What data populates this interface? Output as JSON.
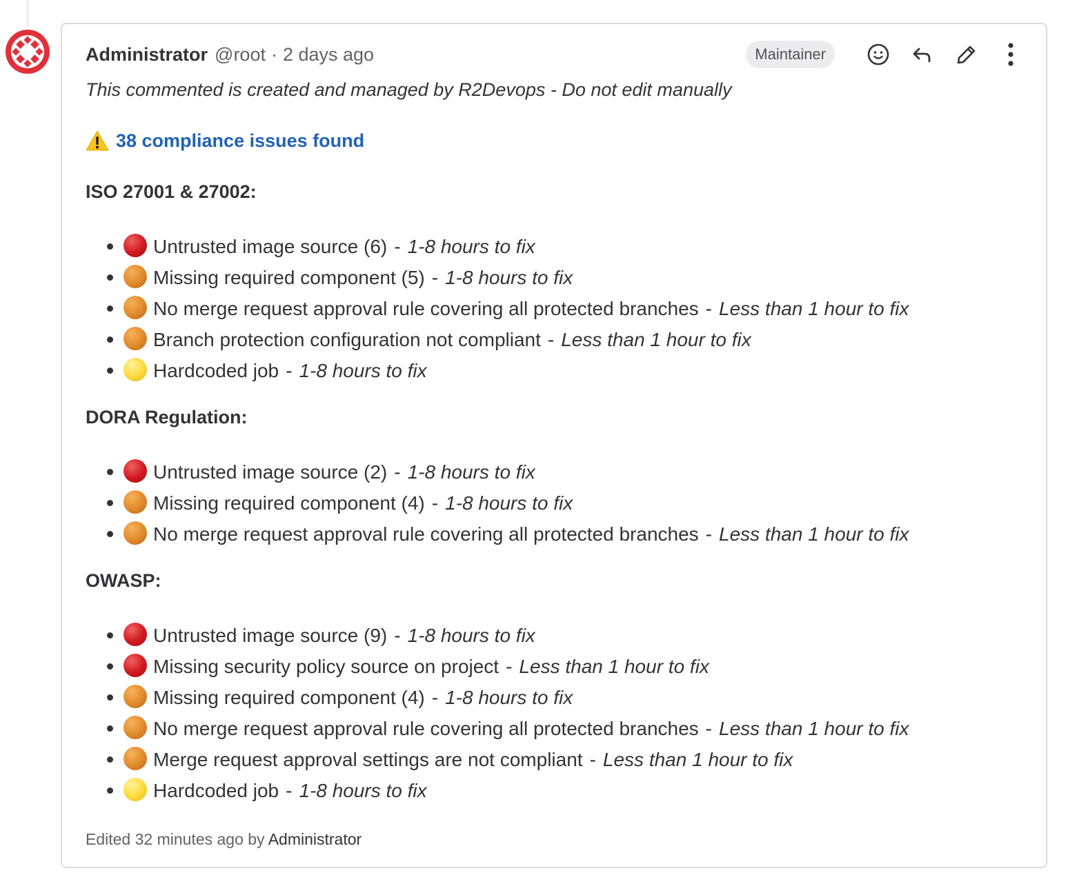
{
  "note": {
    "author_name": "Administrator",
    "author_handle": "@root",
    "separator": "·",
    "timestamp": "2 days ago",
    "role_badge": "Maintainer",
    "actions": [
      "add-reaction",
      "reply",
      "edit",
      "more-actions"
    ],
    "intro": "This commented is created and managed by R2Devops - Do not edit manually",
    "summary": "38 compliance issues found",
    "footer": {
      "edited_prefix": "Edited 32 minutes ago by",
      "edited_by": "Administrator"
    }
  },
  "sections": [
    {
      "title": "ISO 27001 & 27002:",
      "items": [
        {
          "severity": "red",
          "text": "Untrusted image source (6)",
          "time": "1-8 hours to fix"
        },
        {
          "severity": "orange",
          "text": "Missing required component (5)",
          "time": "1-8 hours to fix"
        },
        {
          "severity": "orange",
          "text": "No merge request approval rule covering all protected branches",
          "time": "Less than 1 hour to fix"
        },
        {
          "severity": "orange",
          "text": "Branch protection configuration not compliant",
          "time": "Less than 1 hour to fix"
        },
        {
          "severity": "yellow",
          "text": "Hardcoded job",
          "time": "1-8 hours to fix"
        }
      ]
    },
    {
      "title": "DORA Regulation:",
      "items": [
        {
          "severity": "red",
          "text": "Untrusted image source (2)",
          "time": "1-8 hours to fix"
        },
        {
          "severity": "orange",
          "text": "Missing required component (4)",
          "time": "1-8 hours to fix"
        },
        {
          "severity": "orange",
          "text": "No merge request approval rule covering all protected branches",
          "time": "Less than 1 hour to fix"
        }
      ]
    },
    {
      "title": "OWASP:",
      "items": [
        {
          "severity": "red",
          "text": "Untrusted image source (9)",
          "time": "1-8 hours to fix"
        },
        {
          "severity": "red",
          "text": "Missing security policy source on project",
          "time": "Less than 1 hour to fix"
        },
        {
          "severity": "orange",
          "text": "Missing required component (4)",
          "time": "1-8 hours to fix"
        },
        {
          "severity": "orange",
          "text": "No merge request approval rule covering all protected branches",
          "time": "Less than 1 hour to fix"
        },
        {
          "severity": "orange",
          "text": "Merge request approval settings are not compliant",
          "time": "Less than 1 hour to fix"
        },
        {
          "severity": "yellow",
          "text": "Hardcoded job",
          "time": "1-8 hours to fix"
        }
      ]
    }
  ],
  "colors": {
    "link": "#1f63b6",
    "severity_red": "#d0191f",
    "severity_orange": "#e0892a",
    "severity_yellow": "#fcd93a",
    "avatar": "#e0313b"
  }
}
